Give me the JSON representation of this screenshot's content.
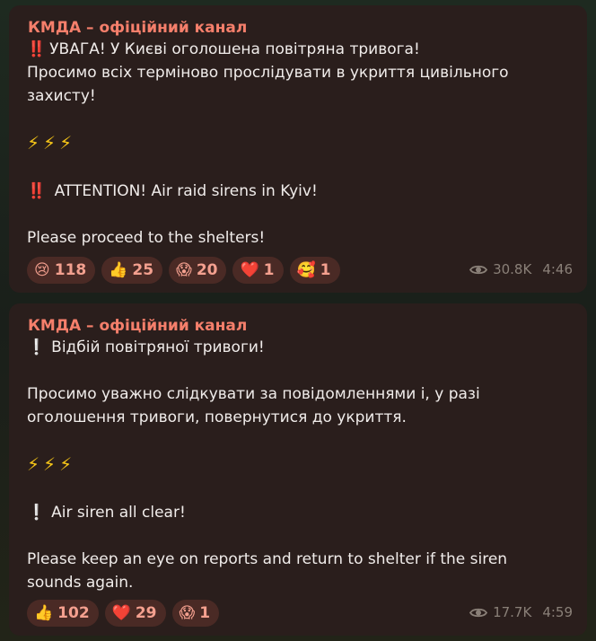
{
  "messages": [
    {
      "sender": "КМДА – офіційний канал",
      "lines": [
        {
          "kind": "alarm",
          "prefix": "‼️",
          "text": "УВАГА! У Києві оголошена повітряна тривога!"
        },
        {
          "kind": "text",
          "text": "Просимо всіх терміново прослідувати в укриття цивільного"
        },
        {
          "kind": "text",
          "text": "захисту!"
        },
        {
          "kind": "gap"
        },
        {
          "kind": "bolts",
          "text": "⚡⚡⚡"
        },
        {
          "kind": "gap"
        },
        {
          "kind": "alarm",
          "prefix": "‼️",
          "text": " ATTENTION! Air raid sirens in Kyiv!"
        },
        {
          "kind": "gap"
        },
        {
          "kind": "text",
          "text": "Please proceed to the shelters!"
        }
      ],
      "reactions": [
        {
          "emoji": "😢",
          "count": "118",
          "name": "crying"
        },
        {
          "emoji": "👍",
          "count": "25",
          "name": "thumbs-up"
        },
        {
          "emoji": "😱",
          "count": "20",
          "name": "screaming"
        },
        {
          "emoji": "❤️",
          "count": "1",
          "name": "heart"
        },
        {
          "emoji": "🥰",
          "count": "1",
          "name": "smiling-hearts"
        }
      ],
      "views": "30.8K",
      "time": "4:46"
    },
    {
      "sender": "КМДА – офіційний канал",
      "lines": [
        {
          "kind": "excl",
          "prefix": "❕",
          "text": "Відбій повітряної тривоги!"
        },
        {
          "kind": "gap"
        },
        {
          "kind": "text",
          "text": "Просимо уважно слідкувати за повідомленнями і, у разі"
        },
        {
          "kind": "text",
          "text": "оголошення тривоги, повернутися до укриття."
        },
        {
          "kind": "gap"
        },
        {
          "kind": "bolts",
          "text": "⚡⚡⚡"
        },
        {
          "kind": "gap"
        },
        {
          "kind": "excl",
          "prefix": "❕",
          "text": "Air siren all clear!"
        },
        {
          "kind": "gap"
        },
        {
          "kind": "text",
          "text": "Please keep an eye on reports and return to shelter if the siren"
        },
        {
          "kind": "text",
          "text": "sounds again."
        }
      ],
      "reactions": [
        {
          "emoji": "👍",
          "count": "102",
          "name": "thumbs-up"
        },
        {
          "emoji": "❤️",
          "count": "29",
          "name": "heart"
        },
        {
          "emoji": "😱",
          "count": "1",
          "name": "screaming"
        }
      ],
      "views": "17.7K",
      "time": "4:59"
    }
  ],
  "colors": {
    "sender": "#f57f6b",
    "bubble": "#2a1e1c",
    "reaction_bg": "#4a2a25",
    "reaction_text": "#f4a08f",
    "meta": "#8a8078"
  },
  "icons": {
    "views": "eye-icon"
  }
}
